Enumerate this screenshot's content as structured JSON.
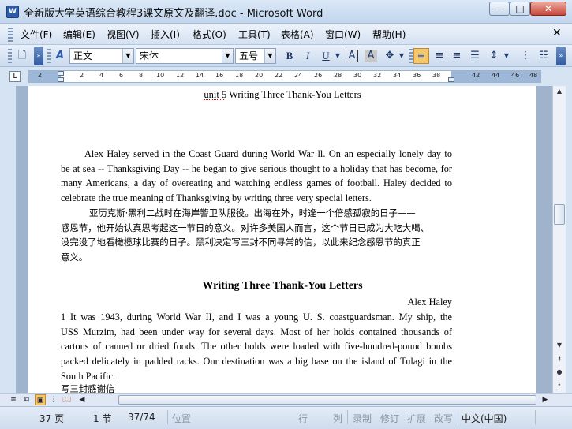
{
  "window": {
    "app_icon": "W",
    "title": "全新版大学英语综合教程3课文原文及翻译.doc - Microsoft Word",
    "minimize": "–",
    "maximize": "□",
    "close": "✕"
  },
  "menu": {
    "items": [
      "文件(F)",
      "编辑(E)",
      "视图(V)",
      "插入(I)",
      "格式(O)",
      "工具(T)",
      "表格(A)",
      "窗口(W)",
      "帮助(H)"
    ],
    "close_doc": "✕"
  },
  "toolbar": {
    "style": "正文",
    "font": "宋体",
    "size": "五号",
    "bold": "B",
    "italic": "I",
    "underline": "U",
    "char_border": "A",
    "char_shading": "A"
  },
  "ruler": {
    "corner": "L",
    "ticks": [
      "2",
      "2",
      "4",
      "6",
      "8",
      "10",
      "12",
      "14",
      "16",
      "18",
      "20",
      "22",
      "24",
      "26",
      "28",
      "30",
      "32",
      "34",
      "36",
      "38",
      "42",
      "44",
      "46",
      "48"
    ]
  },
  "document": {
    "unit_title": "unit 5 Writing Three Thank-You Letters",
    "intro_en": [
      "Alex Haley served in the Coast Guard during World War ll. On an especially lonely day to",
      "be at sea -- Thanksgiving Day -- he began to give serious thought to a holiday that has become, for",
      "many Americans, a day of overeating and watching endless games of football. Haley decided to",
      "celebrate the true meaning of Thanksgiving by writing three very special letters."
    ],
    "intro_cn": [
      "亚历克斯·黑利二战时在海岸警卫队服役。出海在外，时逢一个倍感孤寂的日子——",
      "感恩节，他开始认真思考起这一节日的意义。对许多美国人而言，这个节日已成为大吃大喝、",
      "没完没了地看橄榄球比赛的日子。黑利决定写三封不同寻常的信，以此来纪念感恩节的真正",
      "意义。"
    ],
    "heading": "Writing Three Thank-You Letters",
    "author": "Alex Haley",
    "para1": [
      "1      It was 1943, during World War II, and I was a young U. S. coastguardsman. My ship, the",
      "USS Murzim, had been under way for several days. Most of her holds contained thousands of",
      "cartons of canned or dried foods. The other holds were loaded with five-hundred-pound bombs",
      "packed delicately in padded racks. Our destination was a big base on the island of Tulagi in the",
      "South Pacific."
    ],
    "para1_cn_fragment": "写三封感谢信"
  },
  "status": {
    "page": "37 页",
    "section": "1 节",
    "page_of": "37/74",
    "position": "位置",
    "line": "行",
    "column": "列",
    "rec": "录制",
    "trk": "修订",
    "ext": "扩展",
    "ovr": "改写",
    "language": "中文(中国)"
  },
  "colors": {
    "window_bg": "#d6e3f3",
    "doc_bg": "#9fb3cc",
    "accent_active": "#f6c66a"
  }
}
